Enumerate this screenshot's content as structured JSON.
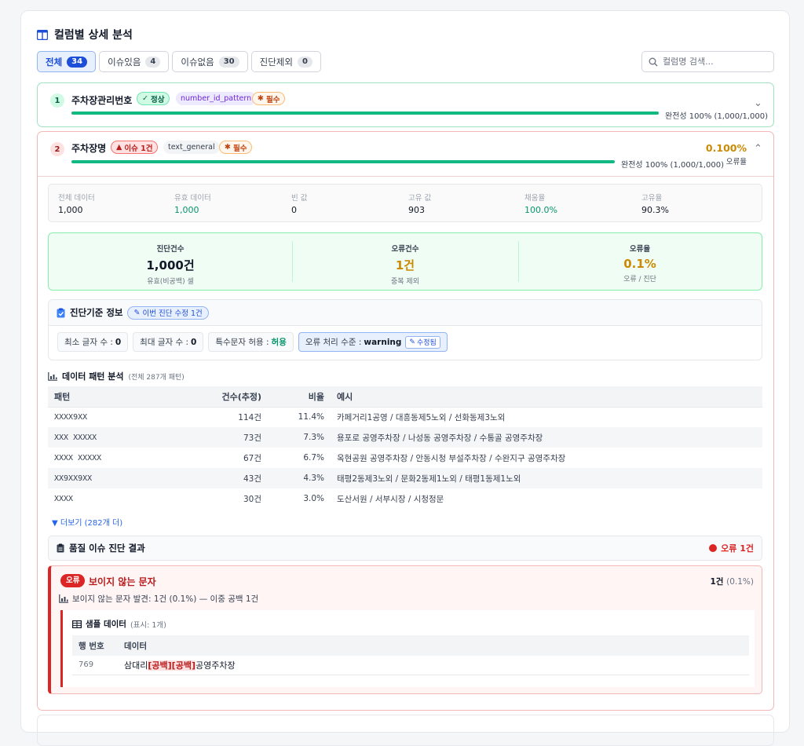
{
  "header": {
    "title": "컬럼별 상세 분석"
  },
  "tabs": [
    {
      "label": "전체",
      "count": "34"
    },
    {
      "label": "이슈있음",
      "count": "4"
    },
    {
      "label": "이슈없음",
      "count": "30"
    },
    {
      "label": "진단제외",
      "count": "0"
    }
  ],
  "search": {
    "placeholder": "컬럼명 검색..."
  },
  "columns": [
    {
      "index": "1",
      "name": "주차장관리번호",
      "status": "정상",
      "type": "number_id_pattern",
      "required": "필수",
      "completeness_text": "완전성 100% (1,000/1,000)",
      "completeness": 1.0
    },
    {
      "index": "2",
      "name": "주차장명",
      "status": "이슈 1건",
      "type": "text_general",
      "required": "필수",
      "completeness_text": "완전성 100% (1,000/1,000)",
      "completeness": 1.0,
      "error_rate": "0.100%",
      "error_rate_label": "오류율"
    }
  ],
  "stats": [
    {
      "label": "전체 데이터",
      "value": "1,000"
    },
    {
      "label": "유효 데이터",
      "value": "1,000"
    },
    {
      "label": "빈 값",
      "value": "0"
    },
    {
      "label": "고유 값",
      "value": "903"
    },
    {
      "label": "채움율",
      "value": "100.0%"
    },
    {
      "label": "고유율",
      "value": "90.3%"
    }
  ],
  "diagnosis": [
    {
      "label": "진단건수",
      "value": "1,000건",
      "sub": "유효(비공백) 셀"
    },
    {
      "label": "오류건수",
      "value": "1건",
      "sub": "중복 제외"
    },
    {
      "label": "오류율",
      "value": "0.1%",
      "sub": "오류 / 진단"
    }
  ],
  "criteria": {
    "title": "진단기준 정보",
    "edit_badge": "이번 진단 수정 1건",
    "chips": [
      {
        "label": "최소 글자 수 :",
        "value": "0"
      },
      {
        "label": "최대 글자 수 :",
        "value": "0"
      },
      {
        "label": "특수문자 허용 :",
        "value": "허용"
      },
      {
        "label": "오류 처리 수준 :",
        "value": "warning",
        "edited": "수정됨"
      }
    ]
  },
  "patterns": {
    "title": "데이터 패턴 분석",
    "subtitle": "(전체 287개 패턴)",
    "headers": [
      "패턴",
      "건수(추정)",
      "비율",
      "예시"
    ],
    "rows": [
      [
        "XXXX9XX",
        "114건",
        "11.4%",
        "카페거리1공영 / 대흥동제5노외 / 선화동제3노외"
      ],
      [
        "XXX XXXXX",
        "73건",
        "7.3%",
        "용포로 공영주차장 / 나성동 공영주차장 / 수통골 공영주차장"
      ],
      [
        "XXXX XXXXX",
        "67건",
        "6.7%",
        "옥현공원 공영주차장 / 안동시청 부설주차장 / 수완지구 공영주차장"
      ],
      [
        "XX9XX9XX",
        "43건",
        "4.3%",
        "태평2동제3노외 / 문화2동제1노외 / 태평1동제1노외"
      ],
      [
        "XXXX",
        "30건",
        "3.0%",
        "도산서원 / 서부시장 / 시청정문"
      ]
    ],
    "more": "▼ 더보기 (282개 더)"
  },
  "quality": {
    "title": "품질 이슈 진단 결과",
    "summary": "오류 1건"
  },
  "issue": {
    "level": "오류",
    "title": "보이지 않는 문자",
    "count": "1건",
    "count_pct": "(0.1%)",
    "description": "보이지 않는 문자 발견: 1건 (0.1%) — 이중 공백 1건",
    "sample_title": "샘플 데이터",
    "sample_sub": "(표시: 1개)",
    "sample_headers": [
      "행 번호",
      "데이터"
    ],
    "sample_row": {
      "row": "769",
      "part1": "삼대리",
      "space1": "[공백]",
      "space2": "[공백]",
      "part2": "공영주차장"
    }
  },
  "colors": {
    "accent": "#1d4ed8",
    "ok": "#10b981",
    "error": "#dc2626",
    "warning": "#ca8a04"
  }
}
